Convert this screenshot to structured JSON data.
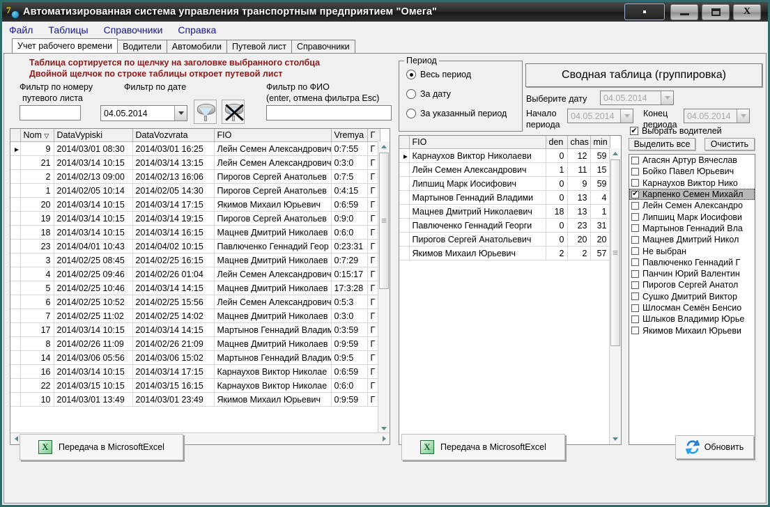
{
  "window": {
    "title": "Автоматизированная система управления транспортным предприятием \"Омега\"",
    "app_icon": "seven-globe-icon",
    "controls": {
      "extra": "·",
      "minimize": "minimize-icon",
      "maximize": "maximize-icon",
      "close": "X"
    }
  },
  "menu": {
    "items": [
      "Файл",
      "Таблицы",
      "Справочники",
      "Справка"
    ]
  },
  "tabs": [
    {
      "label": "Учет рабочего времени",
      "active": true
    },
    {
      "label": "Водители",
      "active": false
    },
    {
      "label": "Автомобили",
      "active": false
    },
    {
      "label": "Путевой лист",
      "active": false
    },
    {
      "label": "Справочники",
      "active": false
    }
  ],
  "hints": {
    "line1": "Таблица сортируется по щелчку на заголовке выбранного столбца",
    "line2": "Двойной щелчок по строке таблицы откроет путевой лист"
  },
  "filters": {
    "by_number_label_1": "Фильтр  по номеру",
    "by_number_label_2": "путевого листа",
    "by_number_value": "",
    "by_date_label": "Фильтр  по дате",
    "by_date_value": "04.05.2014",
    "apply_filter_icon": "funnel-icon",
    "clear_filter_icon": "funnel-clear-icon",
    "by_fio_label": "Фильтр  по ФИО",
    "by_fio_hint": "(enter, отмена фильтра Esc)",
    "by_fio_value": ""
  },
  "main_table": {
    "columns": [
      "Nom",
      "DataVypiski",
      "DataVozvrata",
      "FIO",
      "Vremya",
      "Г"
    ],
    "sort_indicator_column": "Nom",
    "rows": [
      {
        "selected": true,
        "nom": "9",
        "vyp": "2014/03/01  08:30",
        "voz": "2014/03/01  16:25",
        "fio": "Лейн Семен Александрович",
        "vremya": "0:7:55",
        "g": "Г"
      },
      {
        "selected": false,
        "nom": "21",
        "vyp": "2014/03/14  10:15",
        "voz": "2014/03/14  13:15",
        "fio": "Лейн Семен Александрович",
        "vremya": "0:3:0",
        "g": "Г"
      },
      {
        "selected": false,
        "nom": "2",
        "vyp": "2014/02/13  09:00",
        "voz": "2014/02/13  16:06",
        "fio": "Пирогов Сергей Анатольев",
        "vremya": "0:7:5",
        "g": "Г"
      },
      {
        "selected": false,
        "nom": "1",
        "vyp": "2014/02/05  10:14",
        "voz": "2014/02/05  14:30",
        "fio": "Пирогов Сергей Анатольев",
        "vremya": "0:4:15",
        "g": "Г"
      },
      {
        "selected": false,
        "nom": "20",
        "vyp": "2014/03/14  10:15",
        "voz": "2014/03/14  17:15",
        "fio": "Якимов Михаил Юрьевич",
        "vremya": "0:6:59",
        "g": "Г"
      },
      {
        "selected": false,
        "nom": "19",
        "vyp": "2014/03/14  10:15",
        "voz": "2014/03/14  19:15",
        "fio": "Пирогов Сергей Анатольев",
        "vremya": "0:9:0",
        "g": "Г"
      },
      {
        "selected": false,
        "nom": "18",
        "vyp": "2014/03/14  10:15",
        "voz": "2014/03/14  16:15",
        "fio": "Мацнев Дмитрий Николаев",
        "vremya": "0:6:0",
        "g": "Г"
      },
      {
        "selected": false,
        "nom": "23",
        "vyp": "2014/04/01  10:43",
        "voz": "2014/04/02  10:15",
        "fio": "Павлюченко Геннадий Геор",
        "vremya": "0:23:31",
        "g": "Г"
      },
      {
        "selected": false,
        "nom": "3",
        "vyp": "2014/02/25  08:45",
        "voz": "2014/02/25  16:15",
        "fio": "Мацнев Дмитрий Николаев",
        "vremya": "0:7:29",
        "g": "Г"
      },
      {
        "selected": false,
        "nom": "4",
        "vyp": "2014/02/25  09:46",
        "voz": "2014/02/26  01:04",
        "fio": "Лейн Семен Александрович",
        "vremya": "0:15:17",
        "g": "Г"
      },
      {
        "selected": false,
        "nom": "5",
        "vyp": "2014/02/25  10:46",
        "voz": "2014/03/14  14:15",
        "fio": "Мацнев Дмитрий Николаев",
        "vremya": "17:3:28",
        "g": "Г"
      },
      {
        "selected": false,
        "nom": "6",
        "vyp": "2014/02/25  10:52",
        "voz": "2014/02/25  15:56",
        "fio": "Лейн Семен Александрович",
        "vremya": "0:5:3",
        "g": "Г"
      },
      {
        "selected": false,
        "nom": "7",
        "vyp": "2014/02/25  11:02",
        "voz": "2014/02/25  14:02",
        "fio": "Мацнев Дмитрий Николаев",
        "vremya": "0:3:0",
        "g": "Г"
      },
      {
        "selected": false,
        "nom": "17",
        "vyp": "2014/03/14  10:15",
        "voz": "2014/03/14  14:15",
        "fio": "Мартынов Геннадий Владим",
        "vremya": "0:3:59",
        "g": "Г"
      },
      {
        "selected": false,
        "nom": "8",
        "vyp": "2014/02/26  11:09",
        "voz": "2014/02/26  21:09",
        "fio": "Мацнев Дмитрий Николаев",
        "vremya": "0:9:59",
        "g": "Г"
      },
      {
        "selected": false,
        "nom": "14",
        "vyp": "2014/03/06  05:56",
        "voz": "2014/03/06  15:02",
        "fio": "Мартынов Геннадий Владим",
        "vremya": "0:9:5",
        "g": "Г"
      },
      {
        "selected": false,
        "nom": "16",
        "vyp": "2014/03/14  10:15",
        "voz": "2014/03/14  17:15",
        "fio": "Карнаухов Виктор Николае",
        "vremya": "0:6:59",
        "g": "Г"
      },
      {
        "selected": false,
        "nom": "22",
        "vyp": "2014/03/15  10:15",
        "voz": "2014/03/15  16:15",
        "fio": "Карнаухов Виктор Николае",
        "vremya": "0:6:0",
        "g": "Г"
      },
      {
        "selected": false,
        "nom": "10",
        "vyp": "2014/03/01  13:49",
        "voz": "2014/03/01  23:49",
        "fio": "Якимов Михаил Юрьевич",
        "vremya": "0:9:59",
        "g": "Г"
      }
    ]
  },
  "period": {
    "caption": "Период",
    "options": [
      {
        "label": "Весь период",
        "selected": true
      },
      {
        "label": "За дату",
        "selected": false
      },
      {
        "label": "За указанный период",
        "selected": false
      }
    ]
  },
  "summary_header": {
    "title": "Сводная таблица  (группировка)",
    "pick_date_label": "Выберите дату",
    "pick_date_value": "04.05.2014",
    "start_label_1": "Начало",
    "start_label_2": "периода",
    "start_value": "04.05.2014",
    "end_label_1": "Конец",
    "end_label_2": "периода",
    "end_value": "04.05.2014"
  },
  "summary_table": {
    "columns": [
      "FIO",
      "den",
      "chas",
      "min"
    ],
    "rows": [
      {
        "selected": true,
        "fio": "Карнаухов Виктор Николаеви",
        "den": "0",
        "chas": "12",
        "min": "59"
      },
      {
        "selected": false,
        "fio": "Лейн Семен Александрович",
        "den": "1",
        "chas": "11",
        "min": "15"
      },
      {
        "selected": false,
        "fio": "Липшиц Марк Иосифович",
        "den": "0",
        "chas": "9",
        "min": "59"
      },
      {
        "selected": false,
        "fio": "Мартынов Геннадий Владими",
        "den": "0",
        "chas": "13",
        "min": "4"
      },
      {
        "selected": false,
        "fio": "Мацнев Дмитрий Николаевич",
        "den": "18",
        "chas": "13",
        "min": "1"
      },
      {
        "selected": false,
        "fio": "Павлюченко Геннадий Георги",
        "den": "0",
        "chas": "23",
        "min": "31"
      },
      {
        "selected": false,
        "fio": "Пирогов Сергей Анатольевич",
        "den": "0",
        "chas": "20",
        "min": "20"
      },
      {
        "selected": false,
        "fio": "Якимов Михаил Юрьевич",
        "den": "2",
        "chas": "2",
        "min": "57"
      }
    ]
  },
  "drivers_panel": {
    "enable_label": "Выбрать водителей",
    "enable_checked": true,
    "select_all_label": "Выделить все",
    "clear_label": "Очистить",
    "items": [
      {
        "label": "Агасян Артур Вячеслав",
        "checked": false,
        "highlighted": false
      },
      {
        "label": "Бойко Павел Юрьевич",
        "checked": false,
        "highlighted": false
      },
      {
        "label": "Карнаухов Виктор Нико",
        "checked": false,
        "highlighted": false
      },
      {
        "label": "Карпенко Семен Михайл",
        "checked": true,
        "highlighted": true
      },
      {
        "label": "Лейн Семен Александро",
        "checked": false,
        "highlighted": false
      },
      {
        "label": "Липшиц Марк Иосифови",
        "checked": false,
        "highlighted": false
      },
      {
        "label": "Мартынов Геннадий Вла",
        "checked": false,
        "highlighted": false
      },
      {
        "label": "Мацнев Дмитрий Никол",
        "checked": false,
        "highlighted": false
      },
      {
        "label": "Не выбран",
        "checked": false,
        "highlighted": false
      },
      {
        "label": "Павлюченко Геннадий Г",
        "checked": false,
        "highlighted": false
      },
      {
        "label": "Панчин Юрий Валентин",
        "checked": false,
        "highlighted": false
      },
      {
        "label": "Пирогов Сергей Анатол",
        "checked": false,
        "highlighted": false
      },
      {
        "label": "Сушко Дмитрий Виктор",
        "checked": false,
        "highlighted": false
      },
      {
        "label": "Шлосман Семён Бенсио",
        "checked": false,
        "highlighted": false
      },
      {
        "label": "Шлыков Владимир Юрье",
        "checked": false,
        "highlighted": false
      },
      {
        "label": "Якимов Михаил Юрьеви",
        "checked": false,
        "highlighted": false
      }
    ]
  },
  "footer": {
    "excel_left_label": "Передача в MicrosoftExcel",
    "excel_right_label": "Передача в MicrosoftExcel",
    "refresh_label": "Обновить",
    "excel_icon": "excel-icon",
    "refresh_icon": "refresh-icon"
  },
  "colors": {
    "title_bar": "#2b2b2b",
    "window_border": "#2f6b6b",
    "menu_text": "#16168c",
    "hint_text": "#8b1a1a",
    "scroll_arrow": "#5b8c8c"
  }
}
